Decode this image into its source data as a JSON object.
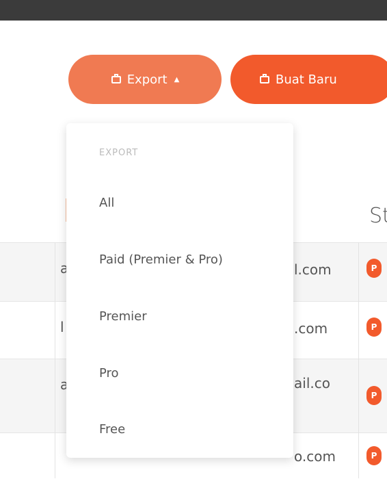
{
  "toolbar": {
    "export_label": "Export",
    "buat_baru_label": "Buat Baru"
  },
  "export_menu": {
    "header": "EXPORT",
    "items": [
      "All",
      "Paid (Premier & Pro)",
      "Premier",
      "Pro",
      "Free"
    ]
  },
  "table": {
    "status_header_partial": "St",
    "rows": [
      {
        "email_prefix": "a",
        "email_suffix": "l.com",
        "badge": "P"
      },
      {
        "email_prefix": "l",
        "email_suffix": ".com",
        "badge": "P"
      },
      {
        "email_prefix": "a",
        "email_suffix": "ail.co",
        "badge": "P"
      },
      {
        "email_prefix": "",
        "email_suffix": "o.com",
        "badge": "P"
      }
    ]
  },
  "colors": {
    "export_button": "#f07a52",
    "buat_baru_button": "#f25a2c",
    "badge": "#f25a2c",
    "topbar": "#3b3b3b"
  }
}
